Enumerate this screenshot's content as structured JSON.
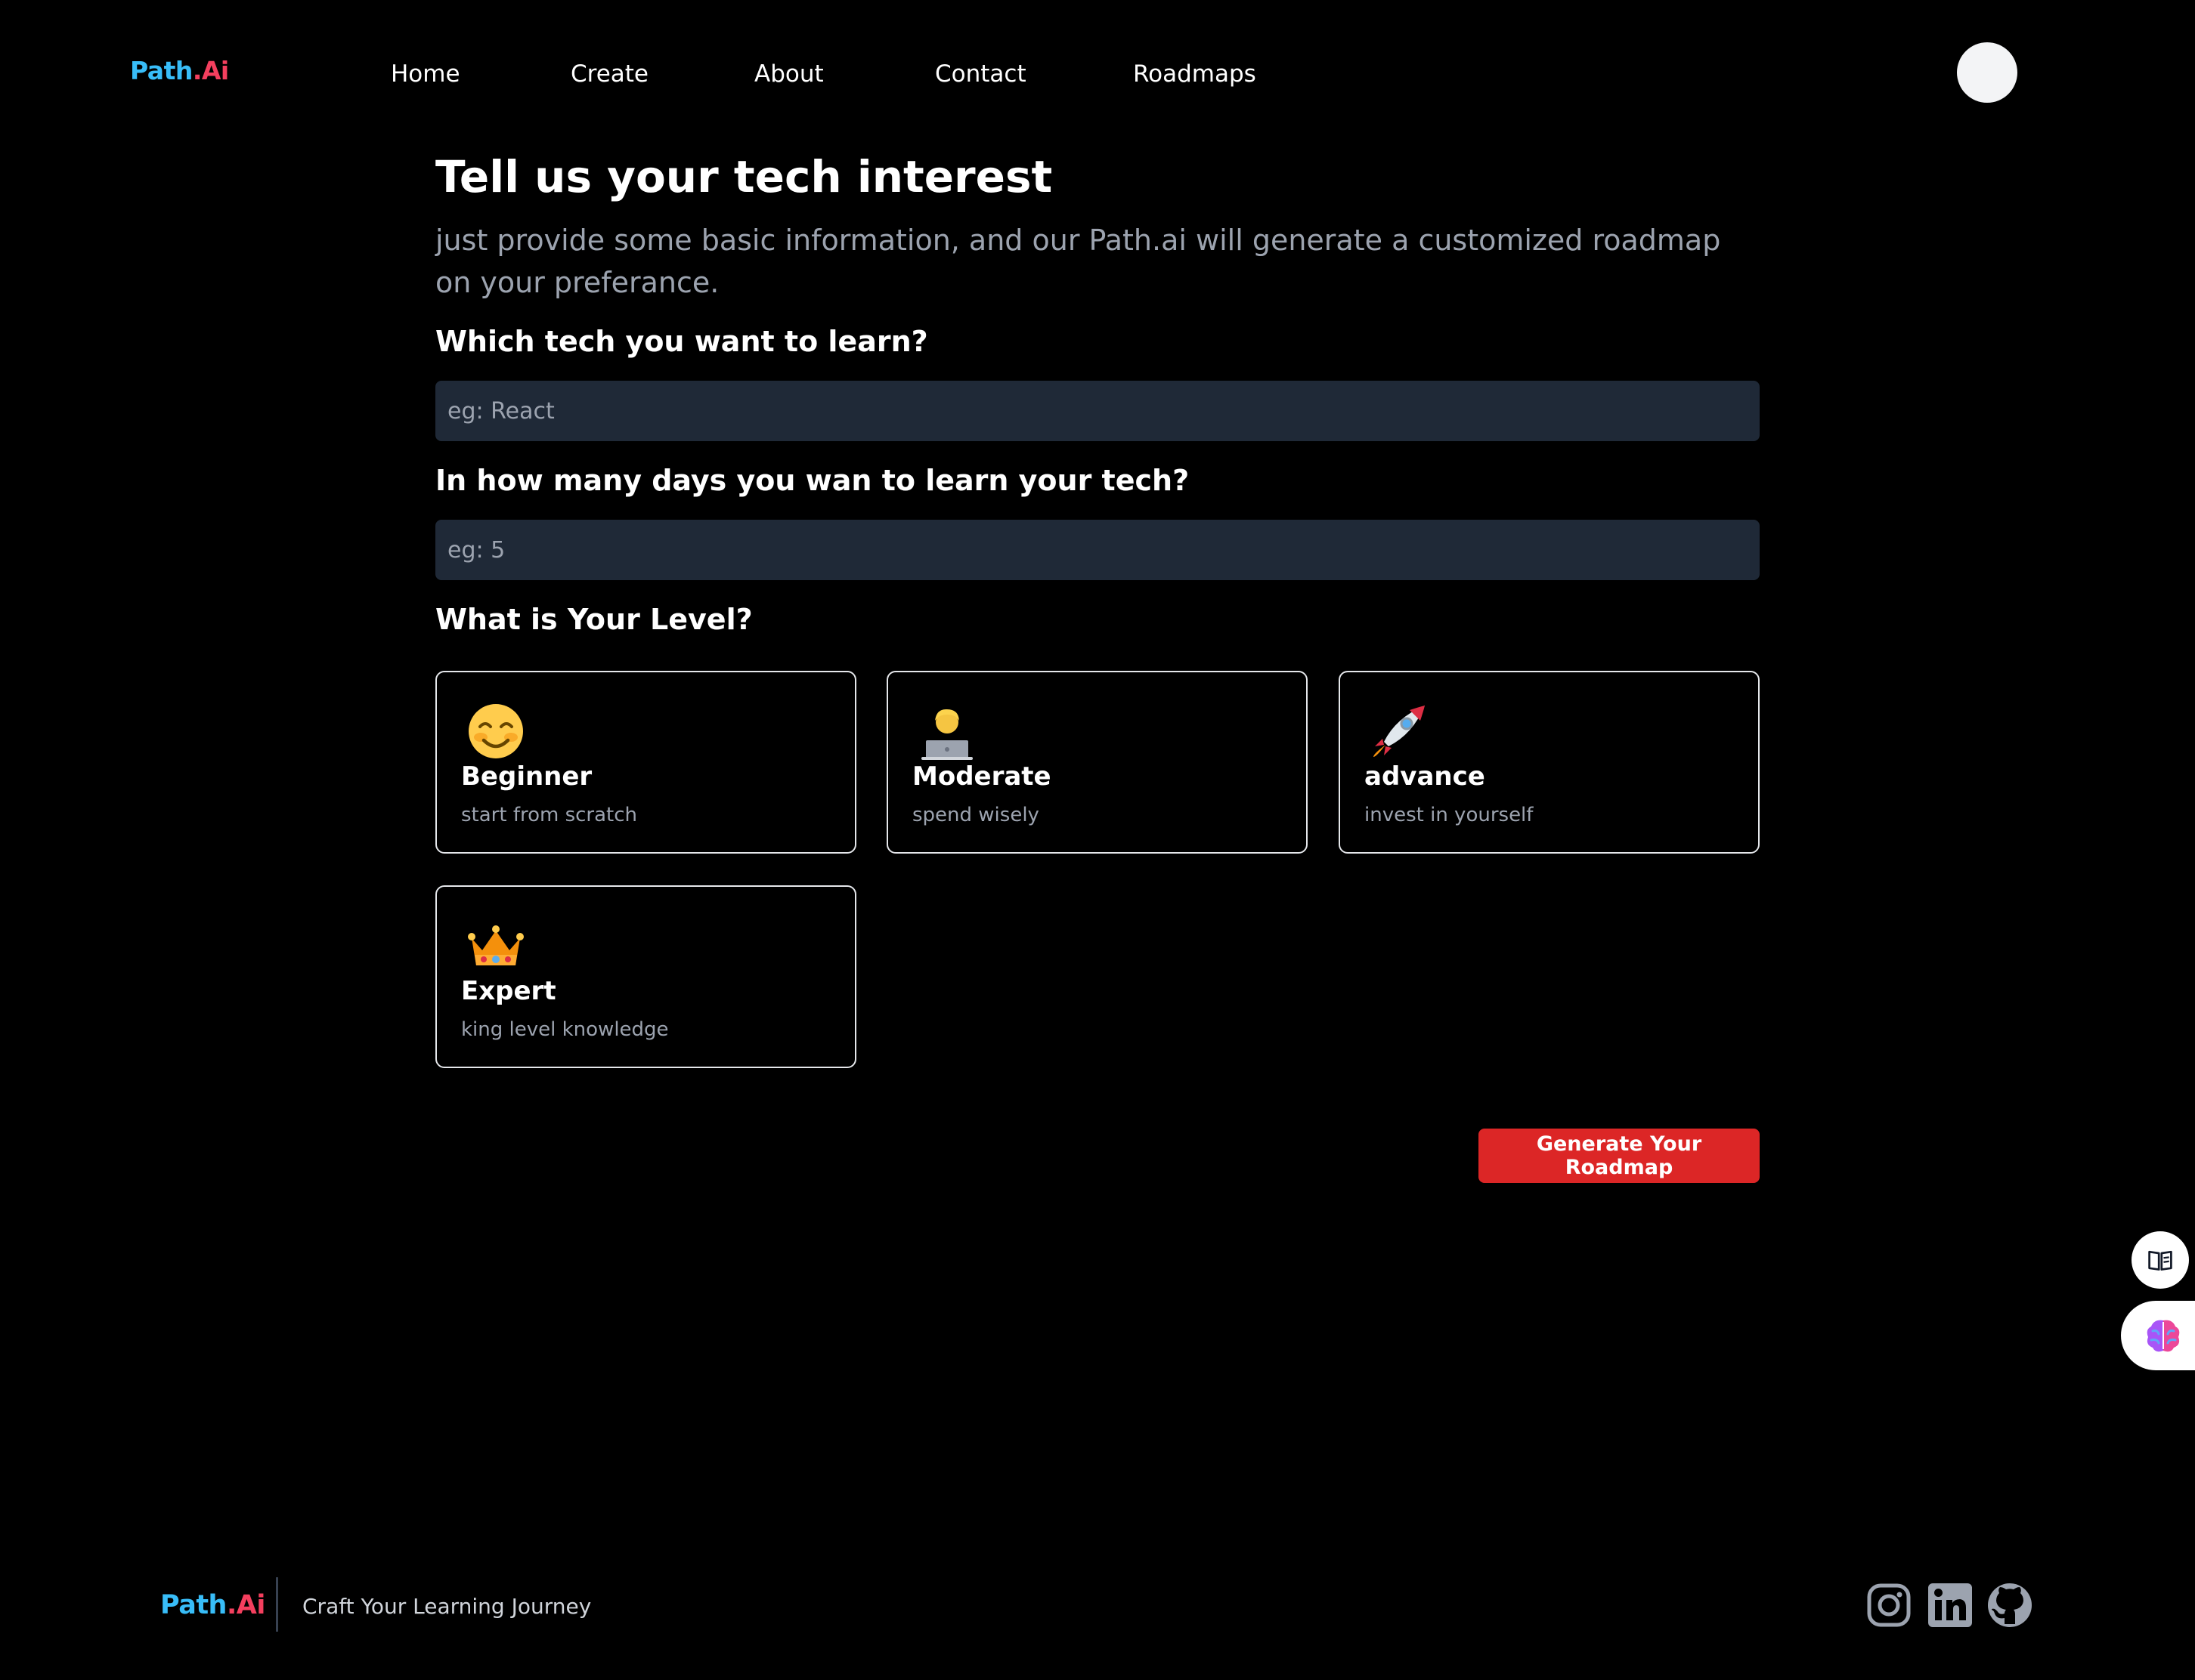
{
  "brand": {
    "name_part1": "Path",
    "name_part2": ".Ai",
    "color_primary": "#38bdf8",
    "color_secondary": "#f43f5e"
  },
  "nav": {
    "items": [
      {
        "label": "Home"
      },
      {
        "label": "Create"
      },
      {
        "label": "About"
      },
      {
        "label": "Contact"
      },
      {
        "label": "Roadmaps"
      }
    ]
  },
  "main": {
    "title": "Tell us your tech interest",
    "subtitle": "just provide some basic information, and our Path.ai will generate a customized roadmap on your preferance.",
    "tech_question": "Which tech you want to learn?",
    "tech_placeholder": "eg: React",
    "tech_value": "",
    "days_question": "In how many days you wan to learn your tech?",
    "days_placeholder": "eg: 5",
    "days_value": "",
    "level_question": "What is Your Level?",
    "levels": [
      {
        "title": "Beginner",
        "desc": "start from scratch",
        "icon": "smiling-face-icon"
      },
      {
        "title": "Moderate",
        "desc": "spend wisely",
        "icon": "technologist-icon"
      },
      {
        "title": "advance",
        "desc": "invest in yourself",
        "icon": "rocket-icon"
      },
      {
        "title": "Expert",
        "desc": "king level knowledge",
        "icon": "crown-icon"
      }
    ],
    "generate_label": "Generate Your Roadmap"
  },
  "side_widgets": [
    {
      "icon": "book-reader-icon"
    },
    {
      "icon": "brain-icon"
    }
  ],
  "footer": {
    "tagline": "Craft Your Learning Journey",
    "social": [
      {
        "icon": "instagram-icon"
      },
      {
        "icon": "linkedin-icon"
      },
      {
        "icon": "github-icon"
      }
    ]
  },
  "colors": {
    "background": "#000000",
    "input_bg": "#1f2937",
    "accent_button": "#dc2626",
    "muted_text": "#9ca3af"
  }
}
